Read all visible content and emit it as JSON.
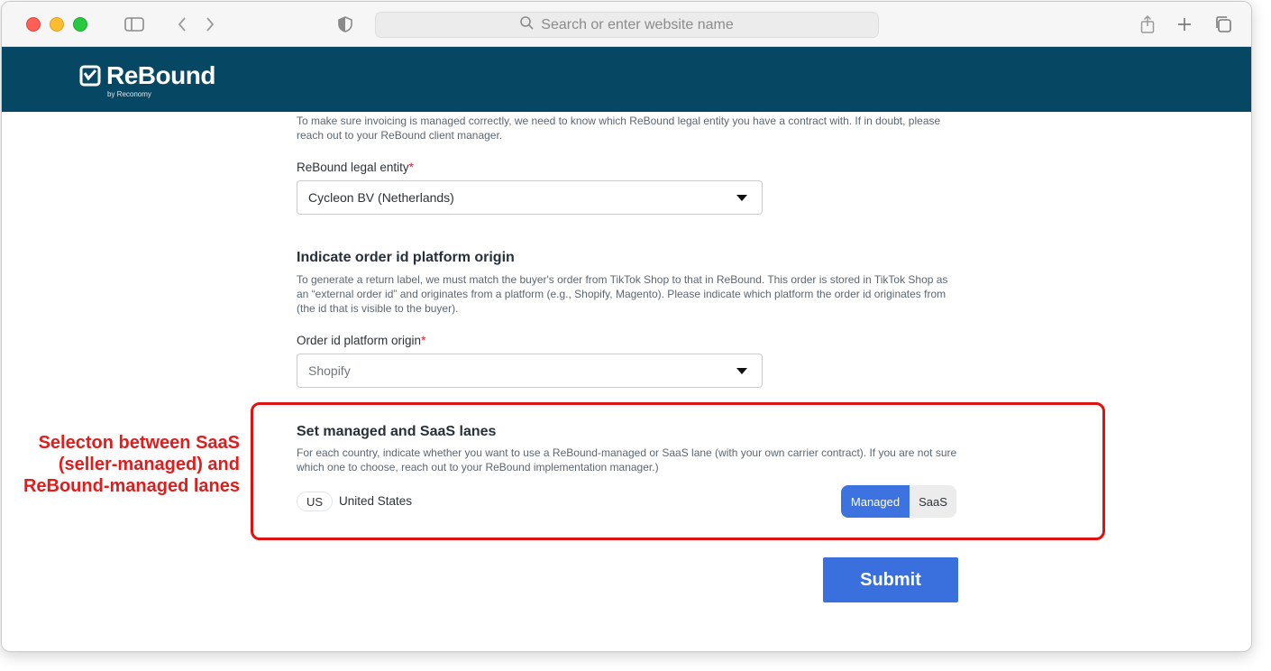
{
  "browser": {
    "address_placeholder": "Search or enter website name"
  },
  "brand": {
    "name": "ReBound",
    "tagline": "by Reconomy",
    "header_color": "#064763"
  },
  "legal_entity": {
    "intro": "To make sure invoicing is managed correctly, we need to know which ReBound legal entity you have a contract with. If in doubt, please reach out to your ReBound client manager.",
    "label": "ReBound legal entity",
    "required_mark": "*",
    "selected": "Cycleon BV (Netherlands)"
  },
  "order_origin": {
    "heading": "Indicate order id platform origin",
    "description": "To generate a return label, we must match the buyer's order from TikTok Shop to that in ReBound. This order is stored in TikTok Shop as an “external order id” and originates from a platform (e.g., Shopify, Magento). Please indicate which platform the order id originates from (the id that is visible to the buyer).",
    "label": "Order id platform origin",
    "required_mark": "*",
    "selected": "Shopify"
  },
  "lanes": {
    "heading": "Set managed and SaaS lanes",
    "description": "For each country, indicate whether you want to use a ReBound-managed or SaaS lane (with your own carrier contract). If you are not sure which one to choose, reach out to your ReBound implementation manager.)",
    "rows": [
      {
        "code": "US",
        "country": "United States",
        "options": [
          "Managed",
          "SaaS"
        ],
        "selected": "Managed"
      }
    ]
  },
  "annotation": {
    "text": "Selecton between SaaS (seller-managed) and ReBound-managed lanes",
    "color": "#e31b1b"
  },
  "submit_label": "Submit",
  "accent_color": "#3a6fde"
}
